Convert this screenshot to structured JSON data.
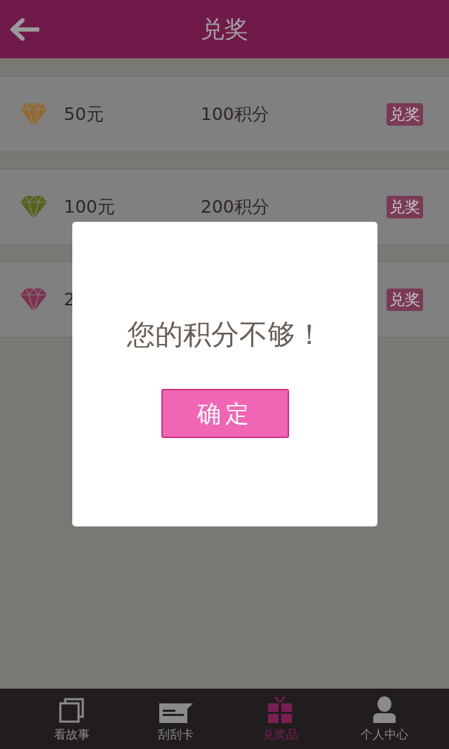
{
  "header": {
    "title": "兑奖"
  },
  "prizes": [
    {
      "color": "#936a2e",
      "name": "50元",
      "points": "100积分",
      "button": "兑奖"
    },
    {
      "color": "#56621c",
      "name": "100元",
      "points": "200积分",
      "button": "兑奖"
    },
    {
      "color": "#7d3050",
      "name": "2",
      "button": "兑奖"
    }
  ],
  "dialog": {
    "message": "您的积分不够！",
    "button": "确定"
  },
  "tab_bar": [
    {
      "label": "看故事",
      "selected": false
    },
    {
      "label": "刮刮卡",
      "selected": false
    },
    {
      "label": "兑奖品",
      "selected": true
    },
    {
      "label": "个人中心",
      "selected": false
    }
  ]
}
